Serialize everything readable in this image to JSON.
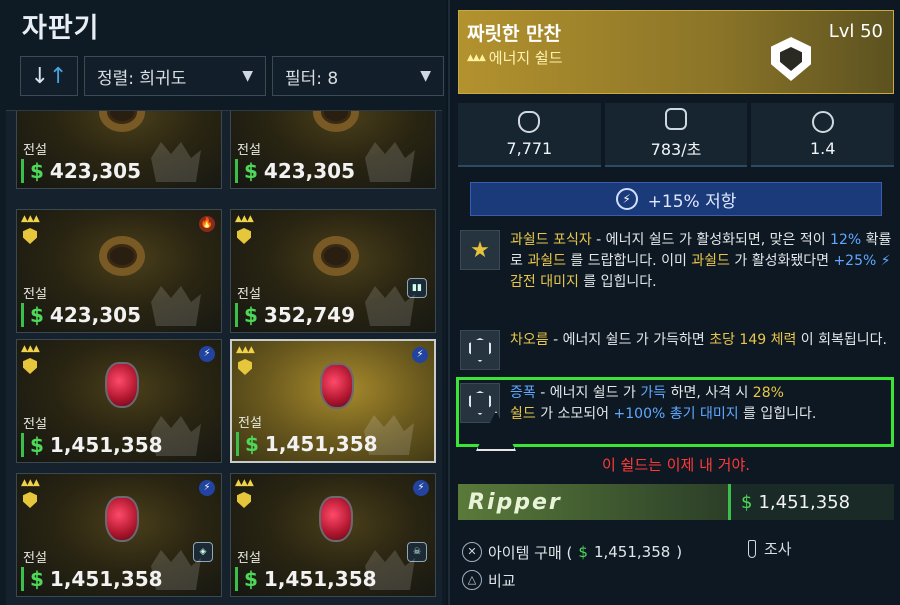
{
  "vending": {
    "title": "자판기",
    "sort_label": "정렬: 희귀도",
    "filter_label": "필터: 8",
    "sort_dir_icon": "sort-arrows-icon"
  },
  "cards": [
    {
      "grade": "전설",
      "price": "423,305",
      "art": "ring",
      "element": "",
      "perk": ""
    },
    {
      "grade": "전설",
      "price": "423,305",
      "art": "ring",
      "element": "",
      "perk": ""
    },
    {
      "grade": "전설",
      "price": "423,305",
      "art": "ring",
      "element": "fire",
      "perk": ""
    },
    {
      "grade": "전설",
      "price": "352,749",
      "art": "ring",
      "element": "",
      "perk": "ammo"
    },
    {
      "grade": "전설",
      "price": "1,451,358",
      "art": "crystal",
      "element": "shock",
      "perk": ""
    },
    {
      "grade": "전설",
      "price": "1,451,358",
      "art": "crystal",
      "element": "shock",
      "perk": ""
    },
    {
      "grade": "전설",
      "price": "1,451,358",
      "art": "crystal",
      "element": "shock",
      "perk": "shield"
    },
    {
      "grade": "전설",
      "price": "1,451,358",
      "art": "crystal",
      "element": "shock",
      "perk": "skull"
    }
  ],
  "detail": {
    "name": "짜릿한 만찬",
    "level": "Lvl 50",
    "type": "에너지 쉴드",
    "stats": [
      {
        "icon": "shield-icon",
        "value": "7,771"
      },
      {
        "icon": "recharge-rate-icon",
        "value": "783/초"
      },
      {
        "icon": "recharge-delay-icon",
        "value": "1.4"
      }
    ],
    "resist": "+15% 저항",
    "perks": [
      {
        "icon": "star-icon",
        "name": "과쉴드 포식자",
        "text1": " - 에너지 쉴드 가 활성화되면, 맞은 적이 ",
        "hl1": "12%",
        "text2": " 확률로 ",
        "hl2": "과쉴드",
        "text3": " 를 드랍합니다. 이미 ",
        "hl3": "과쉴드",
        "text4": " 가 활성화됐다면 ",
        "hl4": "+25%",
        "hl5": "감전 대미지",
        "text5": " 를 입힙니다."
      },
      {
        "icon": "shield-icon",
        "name": "차오름",
        "text1": " - 에너지 쉴드 가 가득하면 ",
        "hl1": "초당 149 체력",
        "text2": " 이 회복됩니다."
      },
      {
        "icon": "shield-burst-icon",
        "name": "증폭",
        "text1": " - 에너지 쉴드 가 ",
        "hl1": "가득",
        "text2": " 하면, 사격 시 ",
        "hl2": "28%",
        "hl3": "쉴드",
        "text3": " 가 소모되어 ",
        "hl4": "+100% 총기 대미지",
        "text4": " 를 입힙니다."
      }
    ],
    "flavor": "이 쉴드는 이제 내 거야.",
    "manufacturer": "Ripper",
    "price": "1,451,358"
  },
  "actions": {
    "buy": "아이템 구매 (",
    "buy_price": "1,451,358",
    "buy_end": ")",
    "inspect": "조사",
    "compare": "비교"
  }
}
